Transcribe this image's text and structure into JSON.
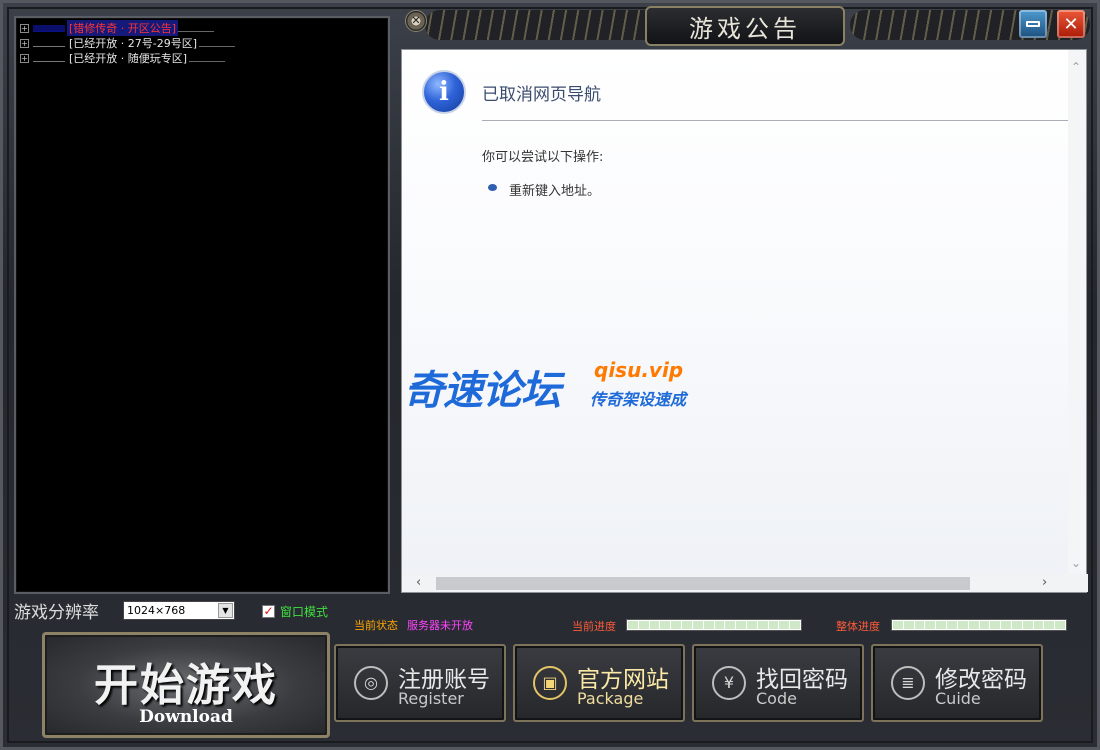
{
  "server_list": {
    "items": [
      {
        "text": "[错修传奇 · 开区公告]",
        "state": "selected"
      },
      {
        "text": "[已经开放 · 27号-29号区]",
        "state": "normal"
      },
      {
        "text": "[已经开放 · 随便玩专区]",
        "state": "normal"
      }
    ]
  },
  "announcement": {
    "title": "游戏公告",
    "browser": {
      "nav_title": "已取消网页导航",
      "try_text": "你可以尝试以下操作:",
      "action_item": "重新键入地址。"
    }
  },
  "watermark": {
    "main": "奇速论坛",
    "domain": "qisu.vip",
    "slogan": "传奇架设速成"
  },
  "settings": {
    "resolution_label": "游戏分辨率",
    "resolution_value": "1024×768",
    "window_mode_label": "窗口模式",
    "window_mode_checked": "✓"
  },
  "status": {
    "label": "当前状态",
    "value": "服务器未开放",
    "current_progress_label": "当前进度",
    "overall_progress_label": "整体进度",
    "current_progress": 0,
    "overall_progress": 0
  },
  "buttons": {
    "start": {
      "main": "开始游戏",
      "sub": "Download"
    },
    "register": {
      "main": "注册账号",
      "sub": "Register"
    },
    "website": {
      "main": "官方网站",
      "sub": "Package"
    },
    "recover": {
      "main": "找回密码",
      "sub": "Code"
    },
    "change": {
      "main": "修改密码",
      "sub": "Cuide"
    }
  },
  "colors": {
    "selected_server": "#ff3434",
    "status_label": "#ffa500",
    "status_value": "#ff44ff",
    "window_mode": "#40e040",
    "watermark_blue": "#1e6ad8",
    "watermark_orange": "#ff7a00"
  }
}
